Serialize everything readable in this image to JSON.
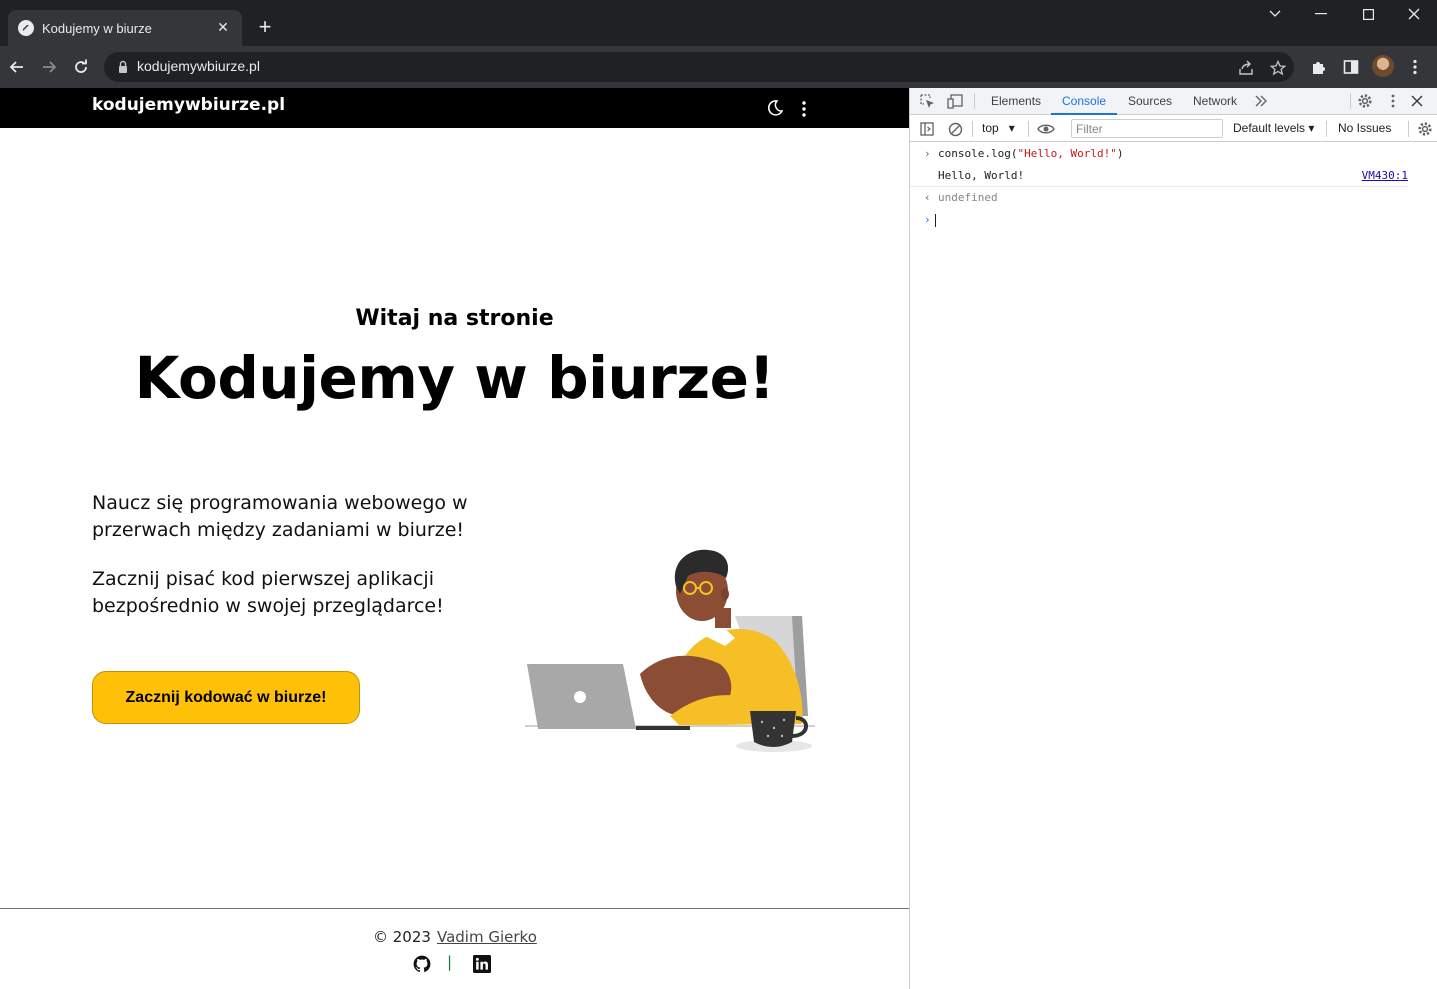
{
  "browser": {
    "tab_title": "Kodujemy w biurze",
    "url": "kodujemywbiurze.pl"
  },
  "site": {
    "logo": "kodujemywbiurze.pl",
    "hero_subtitle": "Witaj na stronie",
    "hero_title": "Kodujemy w biurze!",
    "lead_1": "Naucz się programowania webowego w przerwach między zadaniami w biurze!",
    "lead_2": "Zacznij pisać kod pierwszej aplikacji bezpośrednio w swojej przeglądarce!",
    "cta_label": "Zacznij kodować w biurze!",
    "footer_copy": "© 2023",
    "footer_author": "Vadim Gierko",
    "footer_separator": "|"
  },
  "devtools": {
    "tabs": [
      "Elements",
      "Console",
      "Sources",
      "Network"
    ],
    "active_tab": "Console",
    "context": "top",
    "filter_placeholder": "Filter",
    "levels": "Default levels",
    "issues": "No Issues",
    "console": {
      "input": "console.log(\"Hello, World!\")",
      "input_fn": "console.log(",
      "input_str": "\"Hello, World!\"",
      "input_end": ")",
      "output": "Hello, World!",
      "output_source": "VM430:1",
      "return_value": "undefined"
    }
  },
  "colors": {
    "accent": "#ffc107",
    "devtools_active": "#1a73e8",
    "site_header": "#000000"
  }
}
